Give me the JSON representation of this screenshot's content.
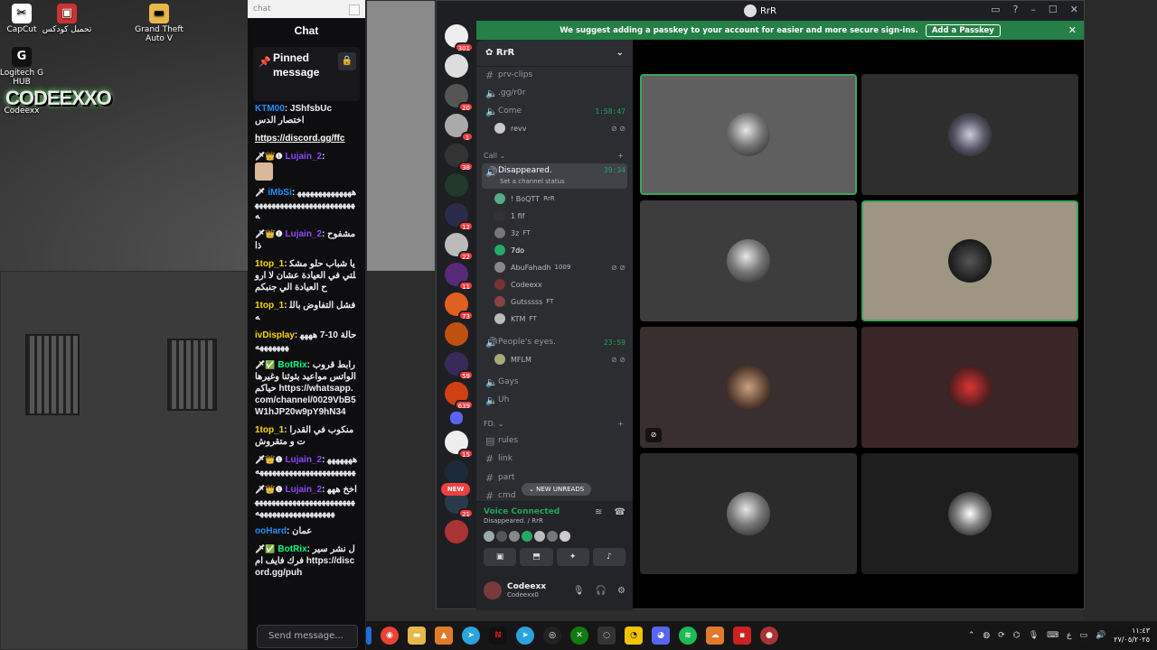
{
  "desktop": {
    "icons": [
      {
        "label": "CapCut",
        "icon": "capcut-icon"
      },
      {
        "label": "تحميل كودكس",
        "icon": "app-icon"
      },
      {
        "label": "Grand Theft Auto V",
        "icon": "folder-icon"
      },
      {
        "label": "Logitech G HUB",
        "icon": "logitech-icon"
      },
      {
        "label": "Codeexx",
        "icon": "app-icon"
      }
    ],
    "wallpaper_text": "CODEEXXO"
  },
  "chat": {
    "url_placeholder": "chat",
    "title": "Chat",
    "pinned_title": "Pinned message",
    "pinned_user": "KTM00",
    "pinned_text": "JShfsbUc",
    "pinned_sub": "اختصار الدس",
    "messages": [
      {
        "user": "",
        "text": "https://discord.gg/ffc",
        "color": "#ffffff"
      },
      {
        "user": "Lujain_2",
        "text": "",
        "color": "#9146ff"
      },
      {
        "user": "iMbSi",
        "text": "ههههههههههههههههههههههههههههههههههههههه",
        "color": "#1e90ff"
      },
      {
        "user": "Lujain_2",
        "text": "مشفوح ذا",
        "color": "#9146ff"
      },
      {
        "user": "1top_1",
        "text": "يا شباب حلو مشكلتي في العيادة عشان لا اروح العيادة الي جنبكم",
        "color": "#ffd700"
      },
      {
        "user": "1top_1",
        "text": "فشل التفاوض بالله",
        "color": "#ffd700"
      },
      {
        "user": "ivDisplay",
        "text": "حالة 10-7 هههههههههههه",
        "color": "#ffd700"
      },
      {
        "user": "BotRix",
        "text": "رابط قروب الواتس مواعيد بثوثنا وغيرها حياكم https://whatsapp.com/channel/0029VbB5W1hJP20w9pY9hN34",
        "color": "#00ff7f"
      },
      {
        "user": "1top_1",
        "text": "منكوب في القدرات و متقروش",
        "color": "#ffd700"
      },
      {
        "user": "Lujain_2",
        "text": "ههههههههههههههههههههههههههههههه",
        "color": "#9146ff"
      },
      {
        "user": "Lujain_2",
        "text": "اخخ هههههههههههههههههههههههههههههههههههههههههههههه",
        "color": "#9146ff"
      },
      {
        "user": "ooHard",
        "text": "عمان",
        "color": "#1e90ff"
      },
      {
        "user": "BotRix",
        "text": "ل نشر سيرفرك فايف ام https://discord.gg/puh",
        "color": "#00ff7f"
      }
    ],
    "input_placeholder": "Send message..."
  },
  "discord": {
    "window_title": "RrR",
    "banner_text": "We suggest adding a passkey to your account for easier and more secure sign-ins.",
    "banner_button": "Add a Passkey",
    "server_name": "RrR",
    "guild_badges": [
      "301",
      "",
      "20",
      "1",
      "38",
      "",
      "12",
      "22",
      "11",
      "73",
      "",
      "59",
      "639",
      "",
      "15",
      "",
      "21",
      ""
    ],
    "new_label": "NEW",
    "channels_top": [
      {
        "name": "prv-clips",
        "type": "text"
      },
      {
        "name": ".gg/r0r",
        "type": "voice"
      },
      {
        "name": "Come",
        "type": "voice",
        "time": "1:58:47"
      }
    ],
    "come_users": [
      {
        "name": "revv"
      }
    ],
    "category_call": "Call",
    "active_channel": {
      "name": "Disappeared.",
      "time": "39:34",
      "status": "Set a channel status"
    },
    "active_users": [
      {
        "name": "! BoQTT",
        "tag": "RrR"
      },
      {
        "name": "1 fif",
        "tag": ""
      },
      {
        "name": "3z",
        "tag": "FT"
      },
      {
        "name": "7do",
        "tag": ""
      },
      {
        "name": "AbuFahadh",
        "tag": "1009"
      },
      {
        "name": "Codeexx",
        "tag": ""
      },
      {
        "name": "Gutsssss",
        "tag": "FT"
      },
      {
        "name": "KTM",
        "tag": "FT"
      }
    ],
    "peoples_eyes": {
      "name": "People's eyes.",
      "time": "23:59",
      "user": "MFLM"
    },
    "channels_mid": [
      {
        "name": "Gays"
      },
      {
        "name": "Uh"
      }
    ],
    "category_fd": "FD.",
    "channels_fd": [
      {
        "name": "rules"
      },
      {
        "name": "link"
      },
      {
        "name": "part"
      },
      {
        "name": "cmd"
      }
    ],
    "new_unreads": "NEW UNREADS",
    "voice_connected": "Voice Connected",
    "voice_sub": "Disappeared. / RrR",
    "user_name": "Codeexx",
    "user_status": "Codeexx0",
    "tiles_bg": [
      "#5f5f5f",
      "#2e2e2e",
      "#3d3d3d",
      "#9e9680",
      "#3a2f2f",
      "#3a2626",
      "#2b2b2b",
      "#1e1e1e"
    ]
  },
  "taskbar": {
    "apps": [
      "file-explorer-icon",
      "chrome-icon",
      "folder-icon",
      "vlc-icon",
      "telegram-icon",
      "netflix-icon",
      "telegram-icon",
      "obs-icon",
      "xbox-icon",
      "capture-icon",
      "app-icon",
      "discord-icon",
      "spotify-icon",
      "cloud-icon",
      "app-icon",
      "app-icon"
    ],
    "lang": "ع",
    "time": "١١:٤٣",
    "date": "٢٧/٠٥/٢٠٢٥"
  },
  "colors": {
    "discord_green": "#248046",
    "speaking": "#3ba55c",
    "badge_red": "#f23f43"
  }
}
